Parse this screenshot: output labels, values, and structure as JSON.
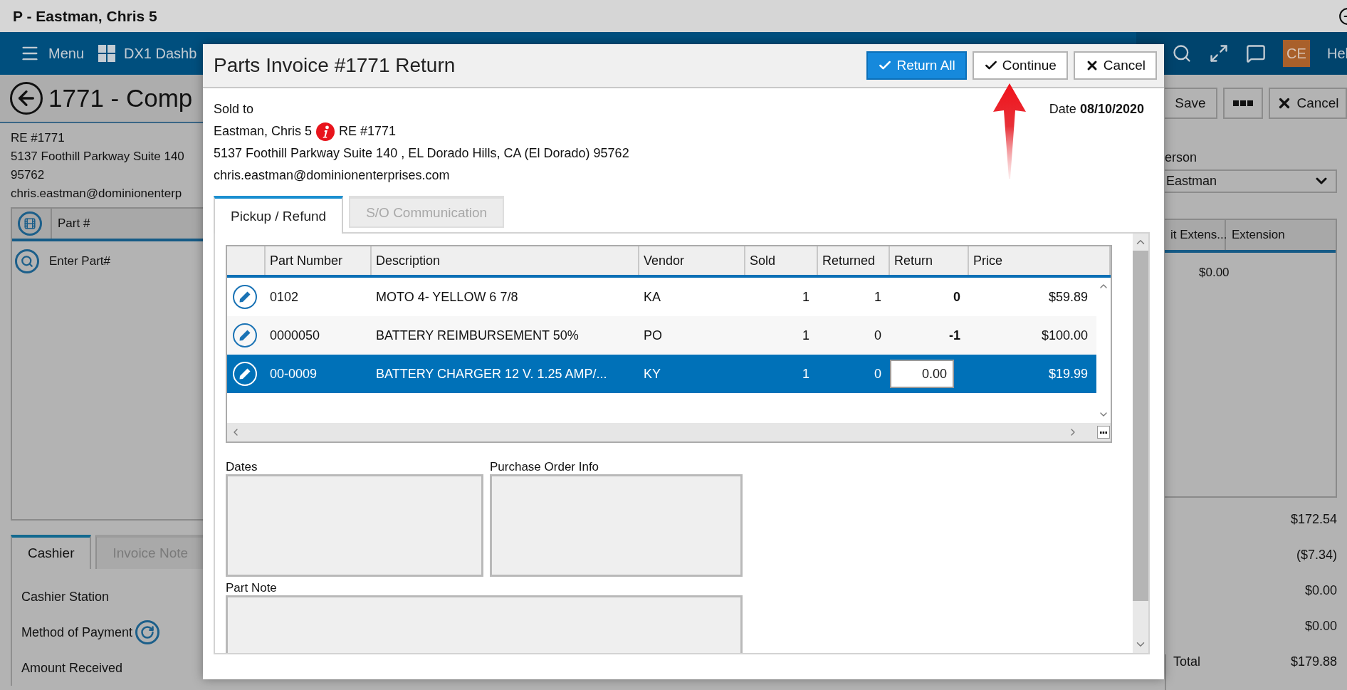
{
  "window": {
    "title": "P - Eastman, Chris 5"
  },
  "nav": {
    "items": [
      {
        "kind": "menu",
        "label": "Menu"
      },
      {
        "kind": "dashboard",
        "label": "DX1 Dashb"
      }
    ],
    "avatar": "CE",
    "help": "Hel"
  },
  "page": {
    "title": "1771 - Comp",
    "info": [
      "RE #1771",
      "5137 Foothill Parkway Suite 140",
      "95762",
      "chris.eastman@dominionenterp"
    ],
    "parts_grid": {
      "column": "Part #",
      "entry": "Enter Part#"
    },
    "tabs": [
      {
        "label": "Cashier",
        "selected": true
      },
      {
        "label": "Invoice Note",
        "selected": false
      }
    ],
    "fields": [
      {
        "kind": "plain",
        "label": "Cashier Station"
      },
      {
        "kind": "refresh",
        "label": "Method of Payment"
      },
      {
        "kind": "plain",
        "label": "Amount Received"
      }
    ]
  },
  "right_panel": {
    "buttons": [
      {
        "kind": "save",
        "label": "Save"
      },
      {
        "kind": "more"
      },
      {
        "kind": "cancel",
        "label": "Cancel"
      }
    ],
    "salesperson_label": "erson",
    "salesperson": "Eastman",
    "columns": [
      "it Extens...",
      "Extension"
    ],
    "extension": "$0.00",
    "totals": [
      "$172.54",
      "($7.34)",
      "$0.00",
      "$0.00"
    ],
    "total": {
      "label": "Total",
      "value": "$179.88"
    }
  },
  "dialog": {
    "title": "Parts Invoice #1771 Return",
    "buttons": [
      {
        "kind": "return_all",
        "label": "Return All"
      },
      {
        "kind": "continue",
        "label": "Continue"
      },
      {
        "kind": "cancel",
        "label": "Cancel"
      }
    ],
    "date": {
      "label": "Date",
      "value": "08/10/2020"
    },
    "sold_to": {
      "label": "Sold to",
      "name": "Eastman, Chris 5",
      "ref": "RE #1771",
      "address": "5137 Foothill Parkway Suite 140 , EL Dorado Hills, CA (El Dorado) 95762",
      "email": "chris.eastman@dominionenterprises.com"
    },
    "tabs": [
      {
        "label": "Pickup / Refund",
        "selected": true
      },
      {
        "label": "S/O Communication",
        "selected": false
      }
    ],
    "grid": {
      "columns": [
        "Part Number",
        "Description",
        "Vendor",
        "Sold",
        "Returned",
        "Return",
        "Price"
      ],
      "rows": [
        {
          "part_number": "0102",
          "description": "MOTO 4- YELLOW 6 7/8",
          "vendor": "KA",
          "sold": "1",
          "returned": "1",
          "return": "0",
          "price": "$59.89",
          "selected": false,
          "editing": false
        },
        {
          "part_number": "0000050",
          "description": "BATTERY REIMBURSEMENT 50%",
          "vendor": "PO",
          "sold": "1",
          "returned": "0",
          "return": "-1",
          "price": "$100.00",
          "selected": false,
          "editing": false
        },
        {
          "part_number": "00-0009",
          "description": "BATTERY CHARGER 12 V. 1.25 AMP/...",
          "vendor": "KY",
          "sold": "1",
          "returned": "0",
          "return": "0.00",
          "price": "$19.99",
          "selected": true,
          "editing": true
        }
      ]
    },
    "sections": [
      "Dates",
      "Purchase Order Info"
    ],
    "note_label": "Part Note"
  }
}
